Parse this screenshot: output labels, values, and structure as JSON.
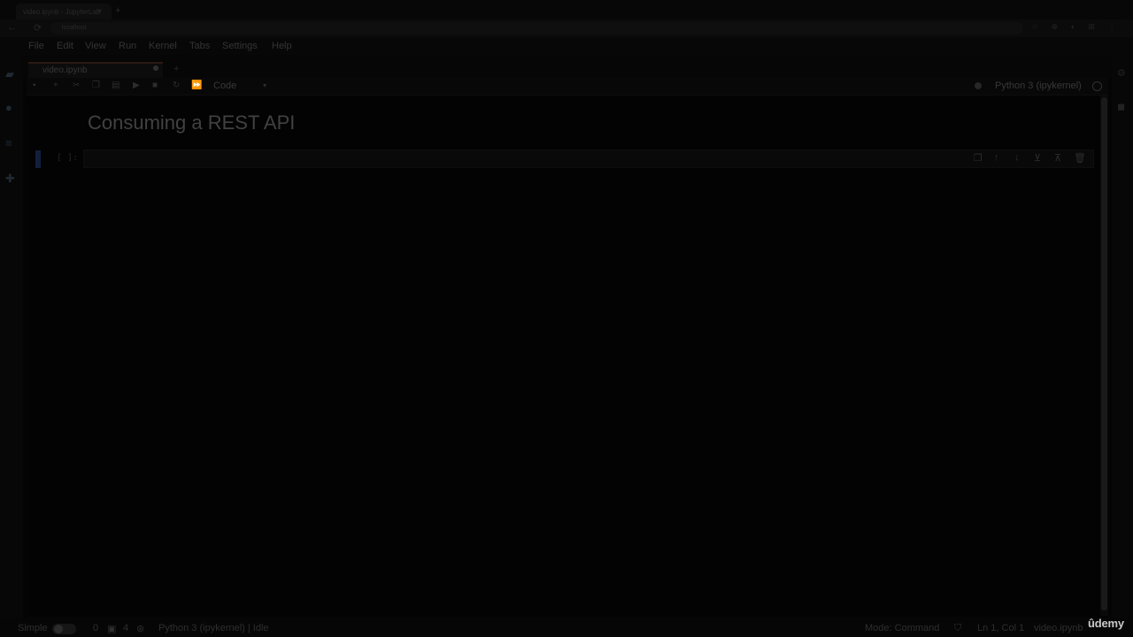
{
  "browser": {
    "tab_title": "video.ipynb - JupyterLab",
    "tab_close": "×",
    "new_tab": "+",
    "back": "←",
    "reload": "⟳",
    "url": "localhost",
    "ext_icons": "☆ ⊕ ◐ ⊞ ⋮"
  },
  "activity": {
    "file_browser_icon": "▰",
    "running_icon": "●",
    "toc_icon": "≡",
    "extensions_icon": "✚"
  },
  "right_bar": {
    "property_inspector_icon": "⚙",
    "debugger_icon": "◼"
  },
  "menubar": {
    "items": [
      "File",
      "Edit",
      "View",
      "Run",
      "Kernel",
      "Tabs",
      "Settings",
      "Help"
    ]
  },
  "notebook_tab": {
    "label": "video.ipynb",
    "new_launcher": "+"
  },
  "toolbar": {
    "save": "▪",
    "insert": "+",
    "cut": "✂",
    "copy": "❐",
    "paste": "▤",
    "run": "▶",
    "interrupt": "■",
    "restart": "↻",
    "restart_run_all": "⏩",
    "cell_type": "Code",
    "chevron": "▾",
    "kernel_name": "Python 3 (ipykernel)"
  },
  "notebook": {
    "heading": "Consuming a REST API",
    "cell_prompt": "[ ]:",
    "cell_tools": {
      "duplicate": "❐",
      "move_up": "↑",
      "move_down": "↓",
      "insert_above": "⊻",
      "insert_below": "⊼",
      "delete": "🗑"
    }
  },
  "statusbar": {
    "simple_label": "Simple",
    "terminals_count": "0",
    "kernels_count": "4",
    "kernel_status": "Python 3 (ipykernel) | Idle",
    "mode": "Mode: Command",
    "cursor": "Ln 1, Col 1",
    "file": "video.ipynb"
  },
  "watermark": {
    "brand": "ûdemy"
  }
}
